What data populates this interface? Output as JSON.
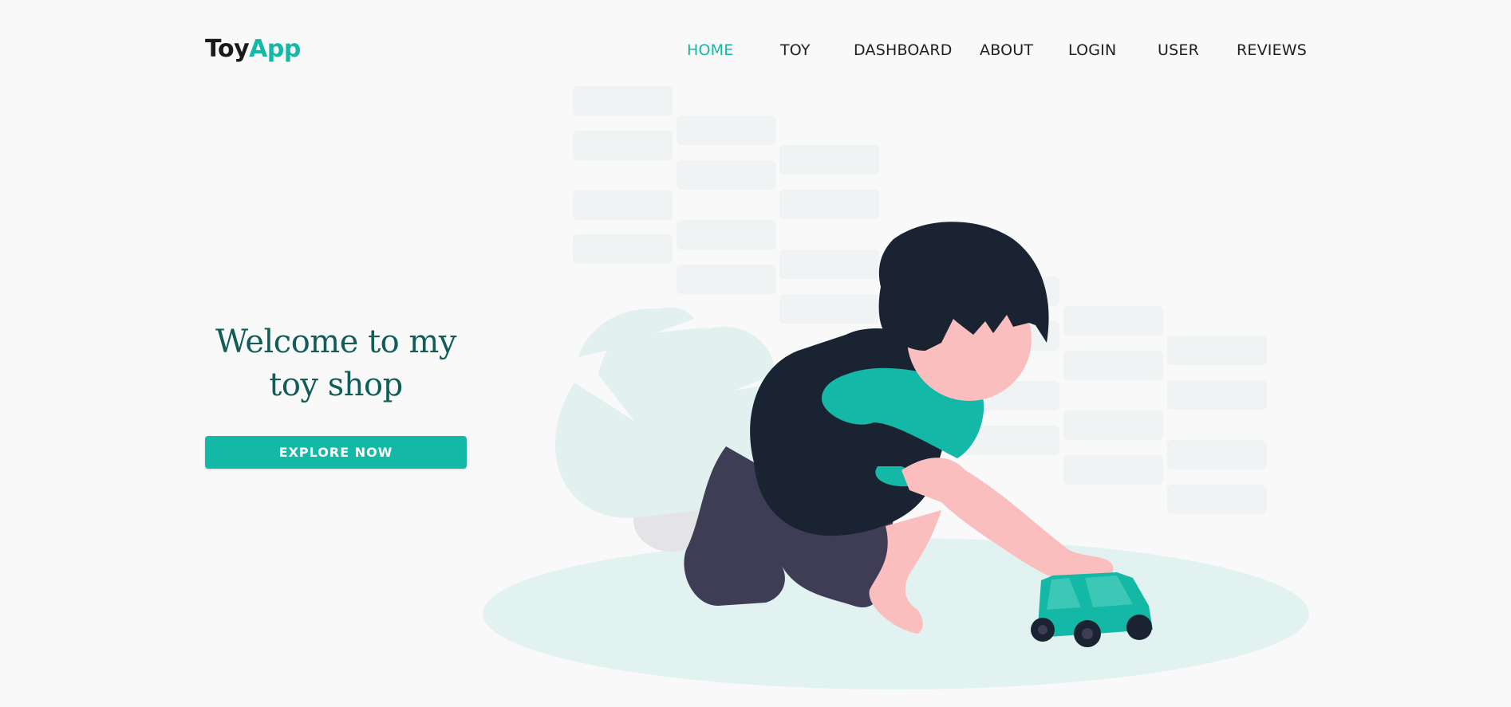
{
  "brand": {
    "name_part1": "Toy",
    "name_part2": "App",
    "accent_color": "#14b8a6",
    "dark_color": "#1a1a1a"
  },
  "nav": {
    "items": [
      {
        "label": "HOME",
        "active": true
      },
      {
        "label": "TOY",
        "active": false
      },
      {
        "label": "DASHBOARD",
        "active": false
      },
      {
        "label": "ABOUT",
        "active": false
      },
      {
        "label": "LOGIN",
        "active": false
      },
      {
        "label": "USER",
        "active": false
      },
      {
        "label": "REVIEWS",
        "active": false
      }
    ]
  },
  "hero": {
    "title_line1": "Welcome to my",
    "title_line2": "toy shop",
    "button_label": "EXPLORE NOW",
    "title_color": "#115e59"
  },
  "illustration": {
    "subject": "child-playing-with-toy-car",
    "icon": "toy-car-icon"
  }
}
